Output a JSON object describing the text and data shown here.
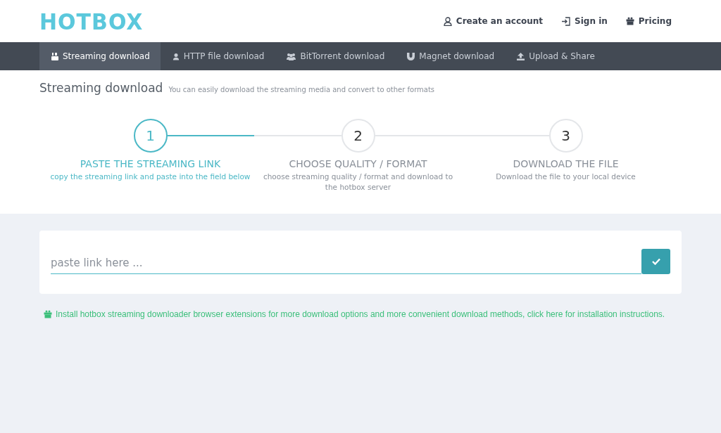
{
  "header": {
    "logo": "HOTBOX",
    "links": [
      {
        "kind": "user",
        "label": "Create an account"
      },
      {
        "kind": "signin",
        "label": "Sign in"
      },
      {
        "kind": "gift",
        "label": "Pricing"
      }
    ]
  },
  "nav": {
    "tabs": [
      {
        "kind": "video",
        "label": "Streaming download",
        "selected": true
      },
      {
        "kind": "user",
        "label": "HTTP file download",
        "selected": false
      },
      {
        "kind": "users",
        "label": "BitTorrent download",
        "selected": false
      },
      {
        "kind": "magnet",
        "label": "Magnet download",
        "selected": false
      },
      {
        "kind": "upload",
        "label": "Upload & Share",
        "selected": false
      }
    ]
  },
  "page": {
    "title": "Streaming download",
    "subtitle": "You can easily download the streaming media and convert to other formats"
  },
  "steps": [
    {
      "number": "1",
      "title": "PASTE THE STREAMING LINK",
      "text": "copy the streaming link and paste into the field below",
      "selected": true
    },
    {
      "number": "2",
      "title": "CHOOSE QUALITY / FORMAT",
      "text": "choose streaming quality / format and download to the hotbox server",
      "selected": false
    },
    {
      "number": "3",
      "title": "DOWNLOAD THE FILE",
      "text": "Download the file to your local device",
      "selected": false
    }
  ],
  "link_form": {
    "placeholder": "paste link here ..."
  },
  "note": "Install hotbox streaming downloader browser extensions for more download options and more convenient download methods, click here for installation instructions."
}
